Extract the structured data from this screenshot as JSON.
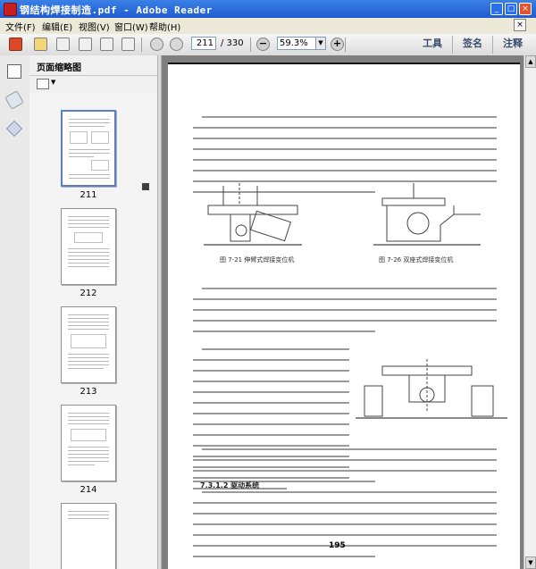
{
  "window": {
    "title": "钢结构焊接制造.pdf - Adobe Reader",
    "controls": {
      "minimize": "_",
      "maximize": "□",
      "close": "×"
    }
  },
  "menu": [
    {
      "label": "文件(F)"
    },
    {
      "label": "编辑(E)"
    },
    {
      "label": "视图(V)"
    },
    {
      "label": "窗口(W)"
    },
    {
      "label": "帮助(H)"
    }
  ],
  "toolbar": {
    "page_current": "211",
    "page_total": "/ 330",
    "zoom": "59.3%",
    "zoom_minus": "−",
    "zoom_plus": "+",
    "tools_label": "工具",
    "sign_label": "签名",
    "comment_label": "注释"
  },
  "pane": {
    "title": "页面缩略图",
    "thumbnails": [
      {
        "label": "211"
      },
      {
        "label": "212"
      },
      {
        "label": "213"
      },
      {
        "label": "214"
      }
    ]
  },
  "document": {
    "heading_section": "7.3.1.2  驱动系统",
    "figure1_caption": "图 7-21  伸臂式焊接变位机",
    "figure2_caption": "图 7-26  双座式焊接变位机",
    "page_number": "195"
  },
  "colors": {
    "titlebar": "#1f5bd0",
    "doc_background": "#7f7f7f"
  }
}
